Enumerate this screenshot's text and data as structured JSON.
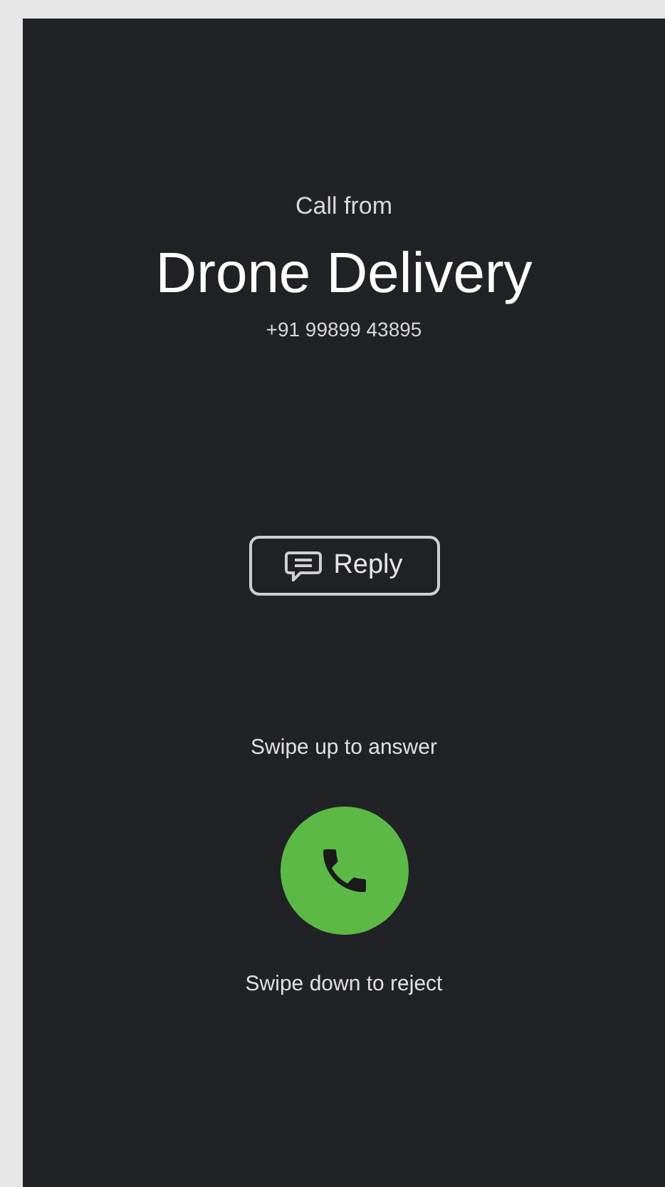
{
  "caller": {
    "caption": "Call from",
    "name": "Drone Delivery",
    "number": "+91 99899 43895"
  },
  "reply_button": {
    "label": "Reply"
  },
  "answer_hint": "Swipe up to answer",
  "reject_hint": "Swipe down to reject"
}
